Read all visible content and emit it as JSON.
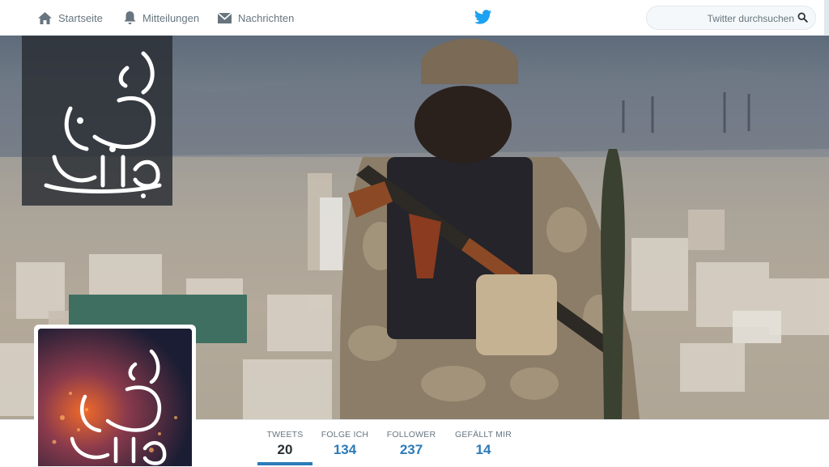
{
  "nav": {
    "home_label": "Startseite",
    "notifications_label": "Mitteilungen",
    "messages_label": "Nachrichten"
  },
  "search": {
    "placeholder": "Twitter durchsuchen"
  },
  "profile": {
    "calligraphy_text": "أبو جهاد الصنعاني"
  },
  "stats": [
    {
      "label": "TWEETS",
      "value": "20"
    },
    {
      "label": "FOLGE ICH",
      "value": "134"
    },
    {
      "label": "FOLLOWER",
      "value": "237"
    },
    {
      "label": "GEFÄLLT MIR",
      "value": "14"
    }
  ],
  "colors": {
    "brand": "#1da1f2",
    "accent": "#2b7bb9",
    "text_muted": "#66757f"
  }
}
